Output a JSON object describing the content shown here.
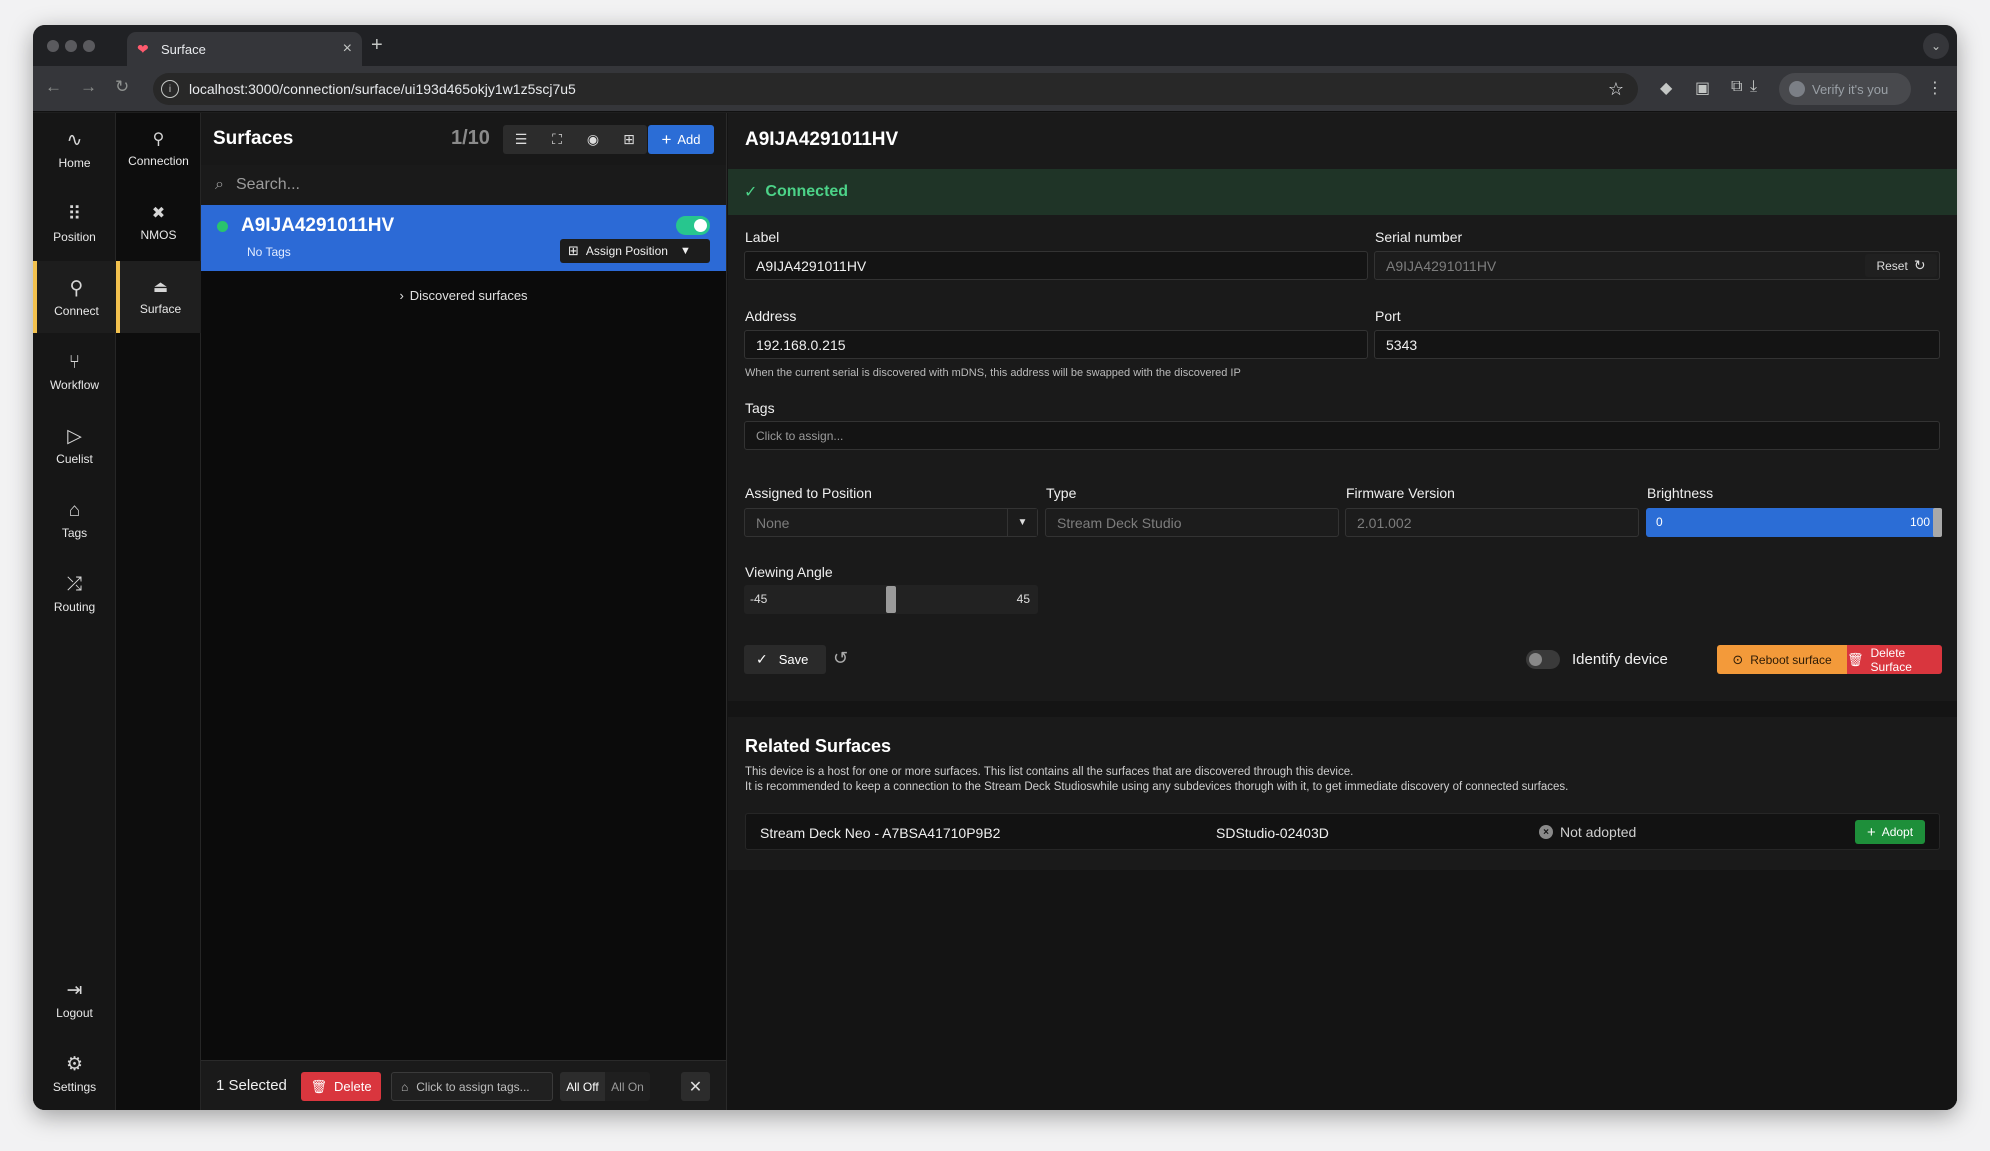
{
  "browser": {
    "tab_title": "Surface",
    "url": "localhost:3000/connection/surface/ui193d465okjy1w1z5scj7u5",
    "verify_label": "Verify it's you"
  },
  "rail": {
    "items": [
      {
        "label": "Home",
        "icon": "pulse-icon"
      },
      {
        "label": "Position",
        "icon": "grid-icon"
      },
      {
        "label": "Connect",
        "icon": "plug-icon",
        "active": true
      },
      {
        "label": "Workflow",
        "icon": "workflow-icon"
      },
      {
        "label": "Cuelist",
        "icon": "play-icon"
      },
      {
        "label": "Tags",
        "icon": "tag-icon"
      },
      {
        "label": "Routing",
        "icon": "shuffle-icon"
      }
    ],
    "logout_label": "Logout",
    "settings_label": "Settings"
  },
  "subrail": {
    "items": [
      {
        "label": "Connection",
        "icon": "plug-icon"
      },
      {
        "label": "NMOS",
        "icon": "nmos-icon"
      },
      {
        "label": "Surface",
        "icon": "joystick-icon",
        "active": true
      }
    ]
  },
  "list": {
    "title": "Surfaces",
    "count": "1/10",
    "add_label": "Add",
    "search_placeholder": "Search...",
    "surface": {
      "name": "A9IJA4291011HV",
      "tags": "No Tags",
      "enabled": true,
      "assign_label": "Assign Position"
    },
    "discovered_label": "Discovered surfaces",
    "footer": {
      "selected": "1 Selected",
      "delete_label": "Delete",
      "tags_placeholder": "Click to assign tags...",
      "all_off": "All Off",
      "all_on": "All On"
    }
  },
  "detail": {
    "title": "A9IJA4291011HV",
    "status": "Connected",
    "label_label": "Label",
    "label_value": "A9IJA4291011HV",
    "serial_label": "Serial number",
    "serial_value": "A9IJA4291011HV",
    "reset_label": "Reset",
    "address_label": "Address",
    "address_value": "192.168.0.215",
    "port_label": "Port",
    "port_value": "5343",
    "address_hint": "When the current serial is discovered with mDNS, this address will be swapped with the discovered IP",
    "tags_label": "Tags",
    "tags_placeholder": "Click to assign...",
    "position_label": "Assigned to Position",
    "position_value": "None",
    "type_label": "Type",
    "type_value": "Stream Deck Studio",
    "firmware_label": "Firmware Version",
    "firmware_value": "2.01.002",
    "brightness_label": "Brightness",
    "brightness_min": "0",
    "brightness_max": "100",
    "brightness_value": 100,
    "viewing_label": "Viewing Angle",
    "viewing_min": "-45",
    "viewing_max": "45",
    "viewing_value": 0,
    "save_label": "Save",
    "identify_label": "Identify device",
    "identify_on": false,
    "reboot_label": "Reboot surface",
    "delete_label": "Delete Surface"
  },
  "related": {
    "title": "Related Surfaces",
    "desc1": "This device is a host for one or more surfaces. This list contains all the surfaces that are discovered through this device.",
    "desc2": "It is recommended to keep a connection to the Stream Deck Studioswhile using any subdevices thorugh with it, to get immediate discovery of connected surfaces.",
    "rows": [
      {
        "name": "Stream Deck Neo - A7BSA41710P9B2",
        "host": "SDStudio-02403D",
        "status": "Not adopted",
        "action": "Adopt"
      }
    ]
  },
  "colors": {
    "accent": "#2b6dd6",
    "active_marker": "#f2c14e",
    "connected": "#4cd388",
    "danger": "#d9363e",
    "warning": "#f39a3a",
    "success": "#1e8f3a"
  }
}
